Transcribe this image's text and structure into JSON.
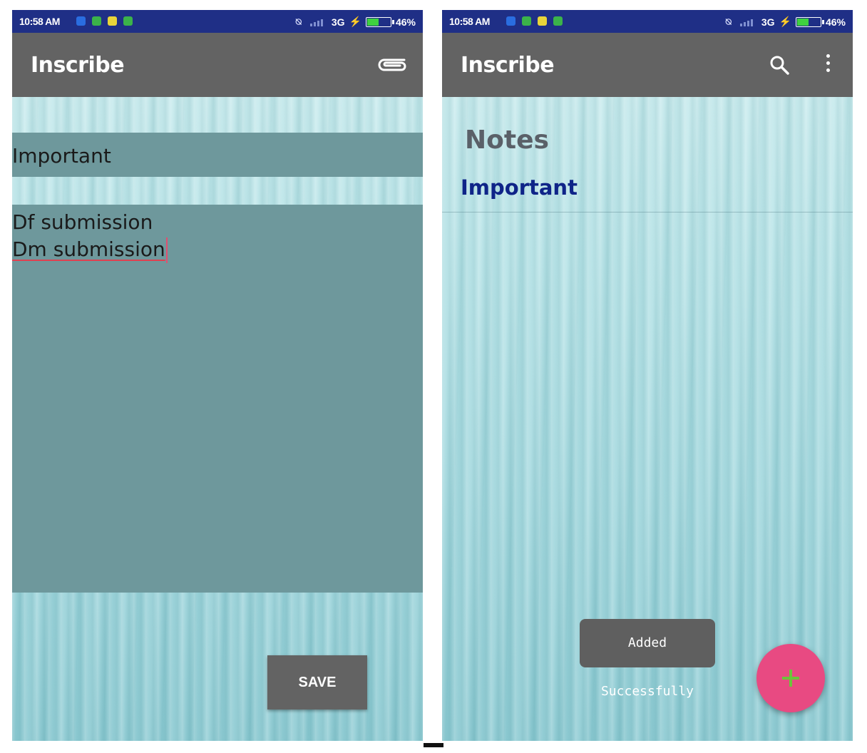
{
  "colors": {
    "status_bar": "#1f2f86",
    "app_bar": "#636363",
    "field_bg": "#6e989c",
    "note_title": "#0f2488",
    "fab": "#e84a82",
    "fab_plus": "#6cc43a",
    "toast_bg": "#5f5f5f"
  },
  "status_bar": {
    "time": "10:58 AM",
    "network": "3G",
    "battery": "46%"
  },
  "editor_screen": {
    "app_title": "Inscribe",
    "attach_icon": "paperclip-icon",
    "title_value": "Important",
    "body_lines": [
      "Df submission",
      "Dm submission"
    ],
    "save_label": "SAVE"
  },
  "list_screen": {
    "app_title": "Inscribe",
    "search_icon": "search-icon",
    "menu_icon": "more-vert-icon",
    "heading": "Notes",
    "notes": [
      {
        "title": "Important"
      }
    ],
    "toast": "Added Successfully",
    "fab_icon": "plus-icon"
  }
}
